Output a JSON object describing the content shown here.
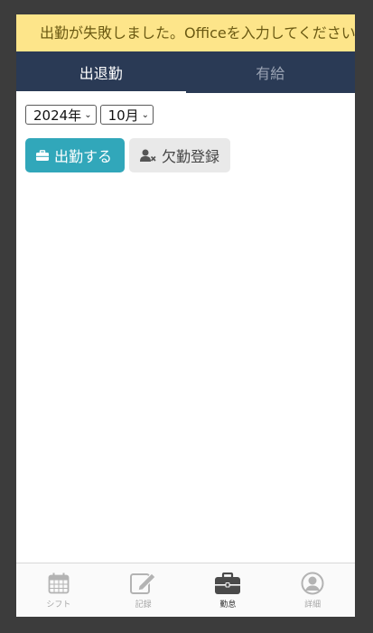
{
  "alert": {
    "message": "出勤が失敗しました。Officeを入力してください"
  },
  "tabs": [
    {
      "label": "出退勤",
      "active": true
    },
    {
      "label": "有給",
      "active": false
    }
  ],
  "filters": {
    "year": "2024年",
    "month": "10月"
  },
  "actions": {
    "clock_in_label": "出勤する",
    "absence_label": "欠勤登録"
  },
  "bottom_nav": [
    {
      "label": "シフト",
      "icon": "calendar-icon"
    },
    {
      "label": "記録",
      "icon": "edit-icon"
    },
    {
      "label": "勤怠",
      "icon": "briefcase-icon",
      "active": true
    },
    {
      "label": "詳細",
      "icon": "user-circle-icon"
    }
  ],
  "colors": {
    "alert_bg": "#fde58a",
    "header_bg": "#2a3a55",
    "primary": "#31a7ba"
  }
}
